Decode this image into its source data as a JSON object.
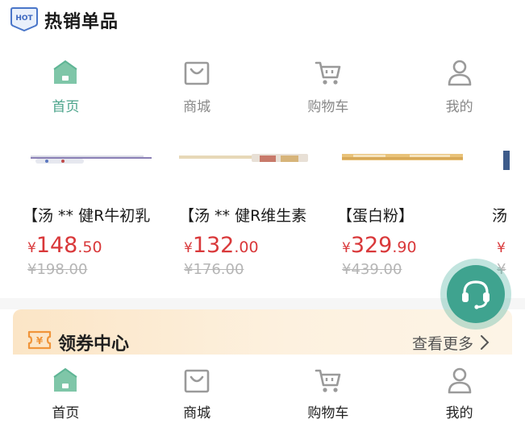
{
  "header": {
    "badge": "HOT",
    "title": "热销单品"
  },
  "top_nav": [
    {
      "label": "首页",
      "icon": "home-icon",
      "active": true
    },
    {
      "label": "商城",
      "icon": "shopping-bag-icon",
      "active": false
    },
    {
      "label": "购物车",
      "icon": "cart-icon",
      "active": false
    },
    {
      "label": "我的",
      "icon": "user-icon",
      "active": false
    }
  ],
  "products": [
    {
      "name": "【汤 ** 健R牛初乳",
      "currency": "¥",
      "price_int": "148",
      "price_dec": ".50",
      "old_price": "¥198.00"
    },
    {
      "name": "【汤 ** 健R维生素",
      "currency": "¥",
      "price_int": "132",
      "price_dec": ".00",
      "old_price": "¥176.00"
    },
    {
      "name": "【蛋白粉】",
      "currency": "¥",
      "price_int": "329",
      "price_dec": ".90",
      "old_price": "¥439.00"
    },
    {
      "name": "汤",
      "currency": "¥",
      "price_int": "",
      "price_dec": "",
      "old_price": "¥"
    }
  ],
  "coupon": {
    "icon_char": "¥",
    "title": "领券中心",
    "more": "查看更多"
  },
  "bottom_nav": [
    {
      "label": "首页",
      "icon": "home-icon",
      "active": true
    },
    {
      "label": "商城",
      "icon": "shopping-bag-icon",
      "active": false
    },
    {
      "label": "购物车",
      "icon": "cart-icon",
      "active": false
    },
    {
      "label": "我的",
      "icon": "user-icon",
      "active": false
    }
  ],
  "colors": {
    "accent": "#4aa38a",
    "price": "#d9383a",
    "old_price": "#b5b5b5",
    "icon_gray": "#9a9a9a",
    "coupon_bg": "#fbe5c6"
  }
}
